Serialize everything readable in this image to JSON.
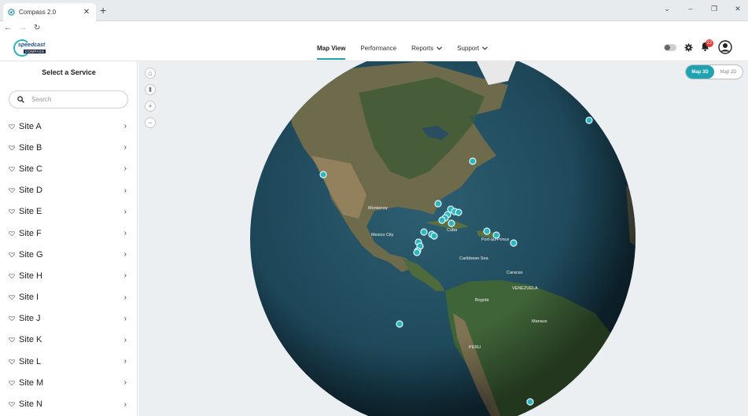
{
  "browser": {
    "tab_title": "Compass 2.0",
    "tab_close": "✕",
    "new_tab": "+",
    "back": "←",
    "forward": "→",
    "reload": "↻",
    "win_chevron": "⌄",
    "win_min": "–",
    "win_max": "❐",
    "win_close": "✕"
  },
  "header": {
    "logo_brand": "speedcast",
    "logo_sub": "COMPASS",
    "nav": [
      {
        "label": "Map View",
        "active": true
      },
      {
        "label": "Performance"
      },
      {
        "label": "Reports",
        "dropdown": true
      },
      {
        "label": "Support",
        "dropdown": true
      }
    ],
    "notification_count": "22",
    "accent_color": "#1fa3b0"
  },
  "sidebar": {
    "title": "Select a Service",
    "search_placeholder": "Search",
    "sites": [
      {
        "label": "Site A"
      },
      {
        "label": "Site B"
      },
      {
        "label": "Site C"
      },
      {
        "label": "Site D"
      },
      {
        "label": "Site E"
      },
      {
        "label": "Site F"
      },
      {
        "label": "Site G"
      },
      {
        "label": "Site H"
      },
      {
        "label": "Site I"
      },
      {
        "label": "Site J"
      },
      {
        "label": "Site K"
      },
      {
        "label": "Site L"
      },
      {
        "label": "Site M"
      },
      {
        "label": "Site N"
      }
    ],
    "collapse_glyph": "‹"
  },
  "map": {
    "toggle_3d": "Map 3D",
    "toggle_2d": "Map 2D",
    "selected_mode": "3D",
    "tools": {
      "home": "⌂",
      "compass": "⬍",
      "zoom_in": "+",
      "zoom_out": "−"
    },
    "labels": {
      "mexico_city": "Mexico City",
      "cuba": "Cuba",
      "caracas": "Caracas",
      "venezuela": "VENEZUELA",
      "bogota": "Bogotá",
      "peru": "PERU",
      "caribbean": "Caribbean Sea",
      "port_au_prince": "Port-au-Prince",
      "monterrey": "Monterrey",
      "manaus": "Manaus"
    }
  }
}
